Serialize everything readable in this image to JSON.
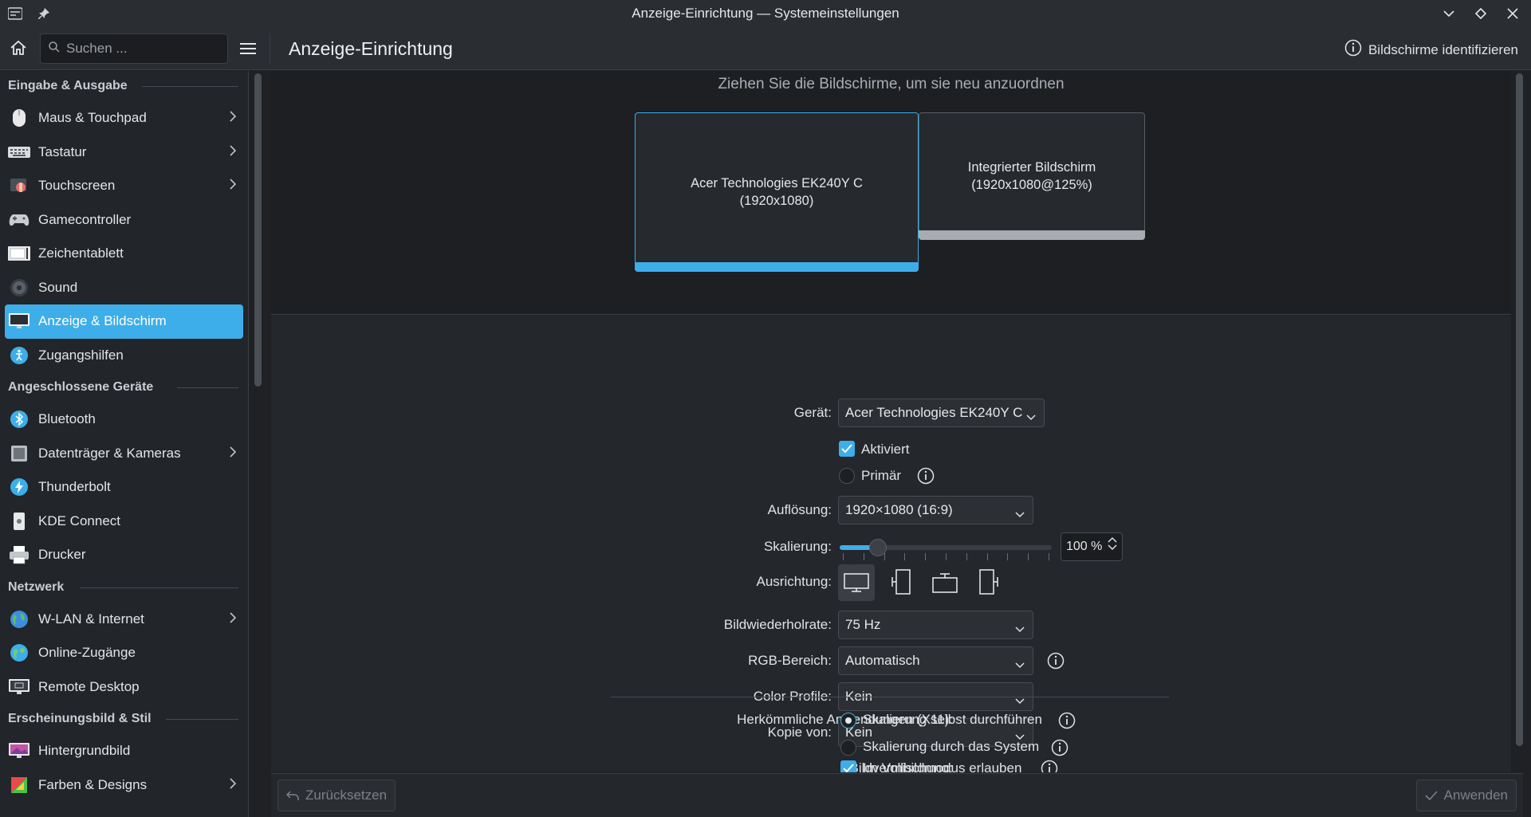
{
  "window": {
    "title": "Anzeige-Einrichtung — Systemeinstellungen"
  },
  "toolbar": {
    "search_placeholder": "Suchen ...",
    "page_title": "Anzeige-Einrichtung",
    "identify_label": "Bildschirme identifizieren"
  },
  "sidebar": {
    "sections": [
      {
        "title": "Eingabe & Ausgabe",
        "items": [
          {
            "label": "Maus & Touchpad",
            "icon": "mouse-icon",
            "chevron": true
          },
          {
            "label": "Tastatur",
            "icon": "keyboard-icon",
            "chevron": true
          },
          {
            "label": "Touchscreen",
            "icon": "touchscreen-icon",
            "chevron": true
          },
          {
            "label": "Gamecontroller",
            "icon": "gamepad-icon",
            "chevron": false
          },
          {
            "label": "Zeichentablett",
            "icon": "tablet-icon",
            "chevron": false
          },
          {
            "label": "Sound",
            "icon": "sound-icon",
            "chevron": false
          },
          {
            "label": "Anzeige & Bildschirm",
            "icon": "display-icon",
            "chevron": false,
            "active": true
          },
          {
            "label": "Zugangshilfen",
            "icon": "accessibility-icon",
            "chevron": false
          }
        ]
      },
      {
        "title": "Angeschlossene Geräte",
        "items": [
          {
            "label": "Bluetooth",
            "icon": "bluetooth-icon",
            "chevron": false
          },
          {
            "label": "Datenträger & Kameras",
            "icon": "drive-icon",
            "chevron": true
          },
          {
            "label": "Thunderbolt",
            "icon": "thunderbolt-icon",
            "chevron": false
          },
          {
            "label": "KDE Connect",
            "icon": "kdeconnect-icon",
            "chevron": false
          },
          {
            "label": "Drucker",
            "icon": "printer-icon",
            "chevron": false
          }
        ]
      },
      {
        "title": "Netzwerk",
        "items": [
          {
            "label": "W-LAN & Internet",
            "icon": "globe-icon",
            "chevron": true
          },
          {
            "label": "Online-Zugänge",
            "icon": "online-accounts-icon",
            "chevron": false
          },
          {
            "label": "Remote Desktop",
            "icon": "remote-desktop-icon",
            "chevron": false
          }
        ]
      },
      {
        "title": "Erscheinungsbild & Stil",
        "items": [
          {
            "label": "Hintergrundbild",
            "icon": "wallpaper-icon",
            "chevron": false
          },
          {
            "label": "Farben & Designs",
            "icon": "colors-icon",
            "chevron": true
          }
        ]
      }
    ]
  },
  "arrange": {
    "hint": "Ziehen Sie die Bildschirme, um sie neu anzuordnen",
    "monitors": [
      {
        "name": "Acer Technologies EK240Y C",
        "mode": "(1920x1080)"
      },
      {
        "name": "Integrierter Bildschirm",
        "mode": "(1920x1080@125%)"
      }
    ]
  },
  "form": {
    "device_label": "Gerät:",
    "device_value": "Acer Technologies EK240Y C",
    "enabled_label": "Aktiviert",
    "primary_label": "Primär",
    "resolution_label": "Auflösung:",
    "resolution_value": "1920×1080 (16:9)",
    "scale_label": "Skalierung:",
    "scale_value": "100 %",
    "scale_fraction": 0.18,
    "orientation_label": "Ausrichtung:",
    "refresh_label": "Bildwiederholrate:",
    "refresh_value": "75 Hz",
    "rgb_label": "RGB-Bereich:",
    "rgb_value": "Automatisch",
    "color_profile_label": "Color Profile:",
    "color_profile_value": "Kein",
    "mirror_label": "Kopie von:",
    "mirror_value": "Kein",
    "legacy_label": "Herkömmliche Anwendungen (X11):",
    "legacy_opt1": "Skalierung selbst durchführen",
    "legacy_opt2": "Skalierung durch das System",
    "tearing_label": "Bildvermischung:",
    "tearing_opt": "Im Vollbildmodus erlauben"
  },
  "footer": {
    "reset_label": "Zurücksetzen",
    "apply_label": "Anwenden"
  },
  "colors": {
    "accent": "#3daee9",
    "window_bg": "#1f2125",
    "panel_bg": "#24272b"
  }
}
